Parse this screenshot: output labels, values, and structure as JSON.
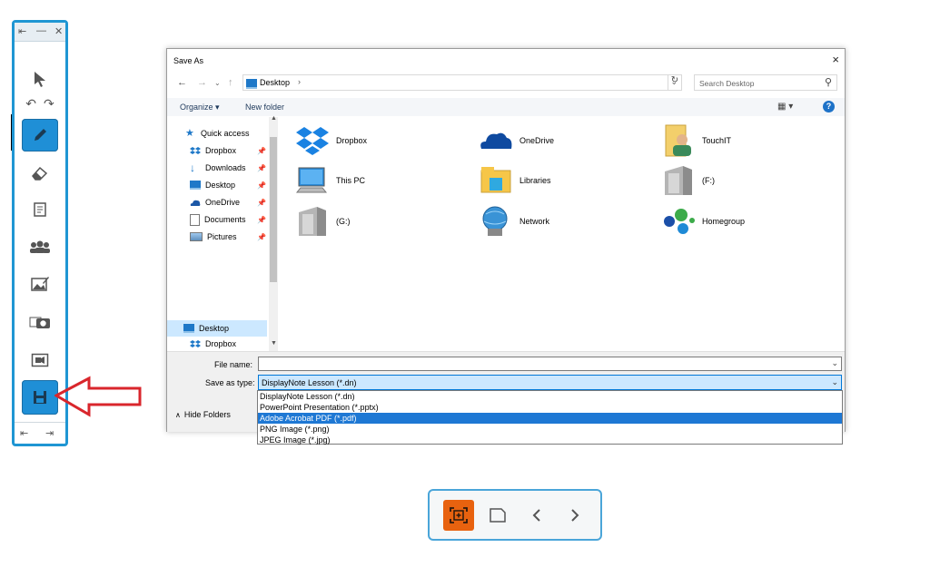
{
  "dialog": {
    "title": "Save As",
    "close_icon": "×",
    "address": {
      "location": "Desktop",
      "chevron": "›"
    },
    "search_placeholder": "Search Desktop",
    "commands": {
      "organize": "Organize ▾",
      "new_folder": "New folder"
    },
    "help": "?",
    "nav_items": [
      {
        "label": "Quick access",
        "icon": "star-icon"
      },
      {
        "label": "Dropbox",
        "icon": "dropbox-icon",
        "pinned": true
      },
      {
        "label": "Downloads",
        "icon": "downloads-icon",
        "pinned": true
      },
      {
        "label": "Desktop",
        "icon": "desktop-icon",
        "pinned": true
      },
      {
        "label": "OneDrive",
        "icon": "onedrive-icon",
        "pinned": true
      },
      {
        "label": "Documents",
        "icon": "documents-icon",
        "pinned": true
      },
      {
        "label": "Pictures",
        "icon": "pictures-icon",
        "pinned": true
      }
    ],
    "nav_selected": "Desktop",
    "nav_partial": "Dropbox",
    "tiles": [
      {
        "label": "Dropbox",
        "icon": "dropbox-icon"
      },
      {
        "label": "OneDrive",
        "icon": "onedrive-icon"
      },
      {
        "label": "TouchIT",
        "icon": "user-folder-icon"
      },
      {
        "label": "This PC",
        "icon": "computer-icon"
      },
      {
        "label": "Libraries",
        "icon": "libraries-icon"
      },
      {
        "label": "(F:)",
        "icon": "drive-icon"
      },
      {
        "label": "(G:)",
        "icon": "drive-icon"
      },
      {
        "label": "Network",
        "icon": "network-icon"
      },
      {
        "label": "Homegroup",
        "icon": "homegroup-icon"
      }
    ],
    "file_name_label": "File name:",
    "file_name_value": "",
    "save_type_label": "Save as type:",
    "save_type_value": "DisplayNote Lesson (*.dn)",
    "hide_folders": "Hide Folders",
    "type_options": [
      "DisplayNote Lesson (*.dn)",
      "PowerPoint Presentation (*.pptx)",
      "Adobe Acrobat PDF (*.pdf)",
      "PNG Image (*.png)",
      "JPEG Image (*.jpg)"
    ],
    "type_option_highlighted": "Adobe Acrobat PDF (*.pdf)"
  },
  "toolbar": {
    "tools": [
      "pointer-icon",
      "undo-icon",
      "redo-icon",
      "pen-icon",
      "eraser-icon",
      "note-icon",
      "participants-icon",
      "image-edit-icon",
      "camera-icon",
      "media-icon",
      "save-icon"
    ],
    "active_tools": [
      "pen-icon",
      "save-icon"
    ]
  },
  "bottom_bar": {
    "buttons": [
      "capture-icon",
      "page-icon",
      "previous-icon",
      "next-icon"
    ]
  },
  "colors": {
    "accent": "#1f96d3",
    "capture_orange": "#e8620f",
    "arrow_red": "#d9262c",
    "selection_blue": "#1e78d4"
  }
}
